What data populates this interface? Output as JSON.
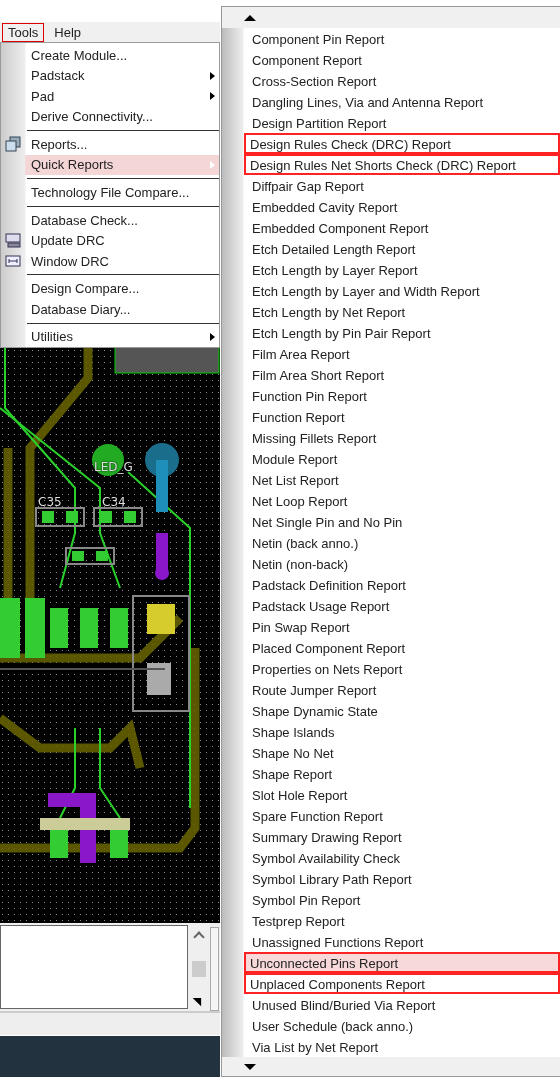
{
  "menubar": [
    {
      "label": "Tools",
      "highlighted": true
    },
    {
      "label": "Help",
      "highlighted": false
    }
  ],
  "tools_menu": [
    {
      "kind": "item",
      "label": "Create Module...",
      "submenu": false,
      "selected": false
    },
    {
      "kind": "item",
      "label": "Padstack",
      "submenu": true,
      "selected": false
    },
    {
      "kind": "item",
      "label": "Pad",
      "submenu": true,
      "selected": false
    },
    {
      "kind": "item",
      "label": "Derive Connectivity...",
      "submenu": false,
      "selected": false
    },
    {
      "kind": "separator"
    },
    {
      "kind": "item",
      "label": "Reports...",
      "submenu": false,
      "selected": false
    },
    {
      "kind": "item",
      "label": "Quick Reports",
      "submenu": true,
      "selected": true
    },
    {
      "kind": "separator"
    },
    {
      "kind": "item",
      "label": "Technology File Compare...",
      "submenu": false,
      "selected": false
    },
    {
      "kind": "separator"
    },
    {
      "kind": "item",
      "label": "Database Check...",
      "submenu": false,
      "selected": false
    },
    {
      "kind": "item",
      "label": "Update DRC",
      "submenu": false,
      "selected": false
    },
    {
      "kind": "item",
      "label": "Window DRC",
      "submenu": false,
      "selected": false
    },
    {
      "kind": "separator"
    },
    {
      "kind": "item",
      "label": "Design Compare...",
      "submenu": false,
      "selected": false
    },
    {
      "kind": "item",
      "label": "Database Diary...",
      "submenu": false,
      "selected": false
    },
    {
      "kind": "separator"
    },
    {
      "kind": "item",
      "label": "Utilities",
      "submenu": true,
      "selected": false
    }
  ],
  "pcb_labels": [
    "C35",
    "C34",
    "LED_G"
  ],
  "quick_reports": [
    {
      "label": "Component Pin Report",
      "selected": false,
      "highlighted": false
    },
    {
      "label": "Component Report",
      "selected": false,
      "highlighted": false
    },
    {
      "label": "Cross-Section Report",
      "selected": false,
      "highlighted": false
    },
    {
      "label": "Dangling Lines, Via and Antenna Report",
      "selected": false,
      "highlighted": false
    },
    {
      "label": "Design Partition Report",
      "selected": false,
      "highlighted": false
    },
    {
      "label": "Design Rules Check (DRC) Report",
      "selected": false,
      "highlighted": true
    },
    {
      "label": "Design Rules Net Shorts Check (DRC) Report",
      "selected": false,
      "highlighted": true
    },
    {
      "label": "Diffpair Gap Report",
      "selected": false,
      "highlighted": false
    },
    {
      "label": "Embedded Cavity Report",
      "selected": false,
      "highlighted": false
    },
    {
      "label": "Embedded Component Report",
      "selected": false,
      "highlighted": false
    },
    {
      "label": "Etch Detailed Length Report",
      "selected": false,
      "highlighted": false
    },
    {
      "label": "Etch Length by Layer Report",
      "selected": false,
      "highlighted": false
    },
    {
      "label": "Etch Length by Layer and Width Report",
      "selected": false,
      "highlighted": false
    },
    {
      "label": "Etch Length by Net Report",
      "selected": false,
      "highlighted": false
    },
    {
      "label": "Etch Length by Pin Pair Report",
      "selected": false,
      "highlighted": false
    },
    {
      "label": "Film Area Report",
      "selected": false,
      "highlighted": false
    },
    {
      "label": "Film Area Short Report",
      "selected": false,
      "highlighted": false
    },
    {
      "label": "Function Pin Report",
      "selected": false,
      "highlighted": false
    },
    {
      "label": "Function Report",
      "selected": false,
      "highlighted": false
    },
    {
      "label": "Missing Fillets Report",
      "selected": false,
      "highlighted": false
    },
    {
      "label": "Module Report",
      "selected": false,
      "highlighted": false
    },
    {
      "label": "Net List Report",
      "selected": false,
      "highlighted": false
    },
    {
      "label": "Net Loop Report",
      "selected": false,
      "highlighted": false
    },
    {
      "label": "Net Single Pin and No Pin",
      "selected": false,
      "highlighted": false
    },
    {
      "label": "Netin (back anno.)",
      "selected": false,
      "highlighted": false
    },
    {
      "label": "Netin (non-back)",
      "selected": false,
      "highlighted": false
    },
    {
      "label": "Padstack Definition Report",
      "selected": false,
      "highlighted": false
    },
    {
      "label": "Padstack Usage Report",
      "selected": false,
      "highlighted": false
    },
    {
      "label": "Pin Swap Report",
      "selected": false,
      "highlighted": false
    },
    {
      "label": "Placed Component Report",
      "selected": false,
      "highlighted": false
    },
    {
      "label": "Properties on Nets Report",
      "selected": false,
      "highlighted": false
    },
    {
      "label": "Route Jumper Report",
      "selected": false,
      "highlighted": false
    },
    {
      "label": "Shape Dynamic State",
      "selected": false,
      "highlighted": false
    },
    {
      "label": "Shape Islands",
      "selected": false,
      "highlighted": false
    },
    {
      "label": "Shape No Net",
      "selected": false,
      "highlighted": false
    },
    {
      "label": "Shape Report",
      "selected": false,
      "highlighted": false
    },
    {
      "label": "Slot Hole Report",
      "selected": false,
      "highlighted": false
    },
    {
      "label": "Spare Function Report",
      "selected": false,
      "highlighted": false
    },
    {
      "label": "Summary Drawing Report",
      "selected": false,
      "highlighted": false
    },
    {
      "label": "Symbol Availability Check",
      "selected": false,
      "highlighted": false
    },
    {
      "label": "Symbol Library Path Report",
      "selected": false,
      "highlighted": false
    },
    {
      "label": "Symbol Pin Report",
      "selected": false,
      "highlighted": false
    },
    {
      "label": "Testprep Report",
      "selected": false,
      "highlighted": false
    },
    {
      "label": "Unassigned Functions Report",
      "selected": false,
      "highlighted": false
    },
    {
      "label": "Unconnected Pins Report",
      "selected": true,
      "highlighted": true
    },
    {
      "label": "Unplaced Components Report",
      "selected": false,
      "highlighted": true
    },
    {
      "label": "Unused Blind/Buried Via Report",
      "selected": false,
      "highlighted": false
    },
    {
      "label": "User Schedule (back anno.)",
      "selected": false,
      "highlighted": false
    },
    {
      "label": "Via List by Net Report",
      "selected": false,
      "highlighted": false
    }
  ]
}
